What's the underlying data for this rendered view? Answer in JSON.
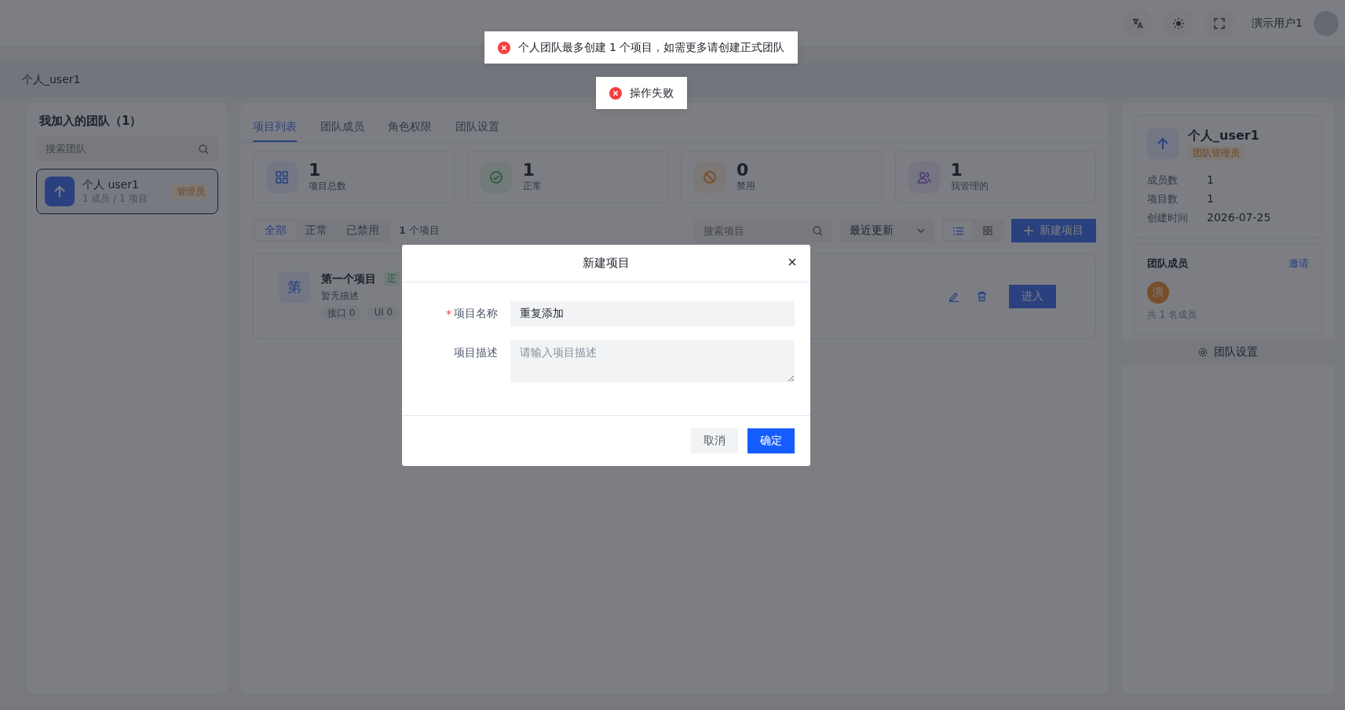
{
  "header": {
    "user_name": "演示用户1"
  },
  "breadcrumb": "个人_user1",
  "teams_panel": {
    "title": "我加入的团队（1）",
    "search": {
      "placeholder": "搜索团队"
    },
    "teams": [
      {
        "name": "个人 user1",
        "meta": "1 成员 / 1 项目",
        "role": "管理员",
        "selected": true
      }
    ]
  },
  "tabs": [
    {
      "label": "项目列表",
      "selected": true
    },
    {
      "label": "团队成员",
      "selected": false
    },
    {
      "label": "角色权限",
      "selected": false
    },
    {
      "label": "团队设置",
      "selected": false
    }
  ],
  "stats": [
    {
      "value": "1",
      "label": "项目总数",
      "kind": "total"
    },
    {
      "value": "1",
      "label": "正常",
      "kind": "normal"
    },
    {
      "value": "0",
      "label": "禁用",
      "kind": "disabled"
    },
    {
      "value": "1",
      "label": "我管理的",
      "kind": "managed"
    }
  ],
  "filters": [
    {
      "label": "全部",
      "selected": true
    },
    {
      "label": "正常",
      "selected": false
    },
    {
      "label": "已禁用",
      "selected": false
    }
  ],
  "project_count": "**1** 个项目",
  "project_search": {
    "placeholder": "搜索项目"
  },
  "sort": "最近更新",
  "view_modes": [
    {
      "kind": "list",
      "selected": true
    },
    {
      "kind": "grid",
      "selected": false
    }
  ],
  "new_button": "新建项目",
  "projects": [
    {
      "avatar": "第",
      "name": "第一个项目",
      "status": "正",
      "description": "暂无描述",
      "tags": [
        "接口 0",
        "UI 0"
      ],
      "enter": "进入"
    }
  ],
  "team_info": {
    "name": "个人_user1",
    "role": "团队管理员",
    "rows": [
      {
        "label": "成员数",
        "value": "1"
      },
      {
        "label": "项目数",
        "value": "1"
      },
      {
        "label": "创建时间",
        "value": "2026-07-25"
      }
    ],
    "members_title": "团队成员",
    "invite": "邀请",
    "members": [
      {
        "initial": "演"
      }
    ],
    "members_total": "共 1 名成员",
    "settings_button": "团队设置"
  },
  "dialog": {
    "title": "新建项目",
    "fields": [
      {
        "kind": "input",
        "required_mark": "*",
        "label": "项目名称",
        "value": "重复添加"
      },
      {
        "kind": "textarea",
        "label": "项目描述",
        "placeholder": "请输入项目描述"
      }
    ],
    "buttons": [
      {
        "kind": "secondary",
        "label": "取消"
      },
      {
        "kind": "primary",
        "label": "确定"
      }
    ]
  },
  "toasts": [
    {
      "text": "个人团队最多创建 1 个项目，如需更多请创建正式团队"
    },
    {
      "text": "操作失败"
    }
  ]
}
